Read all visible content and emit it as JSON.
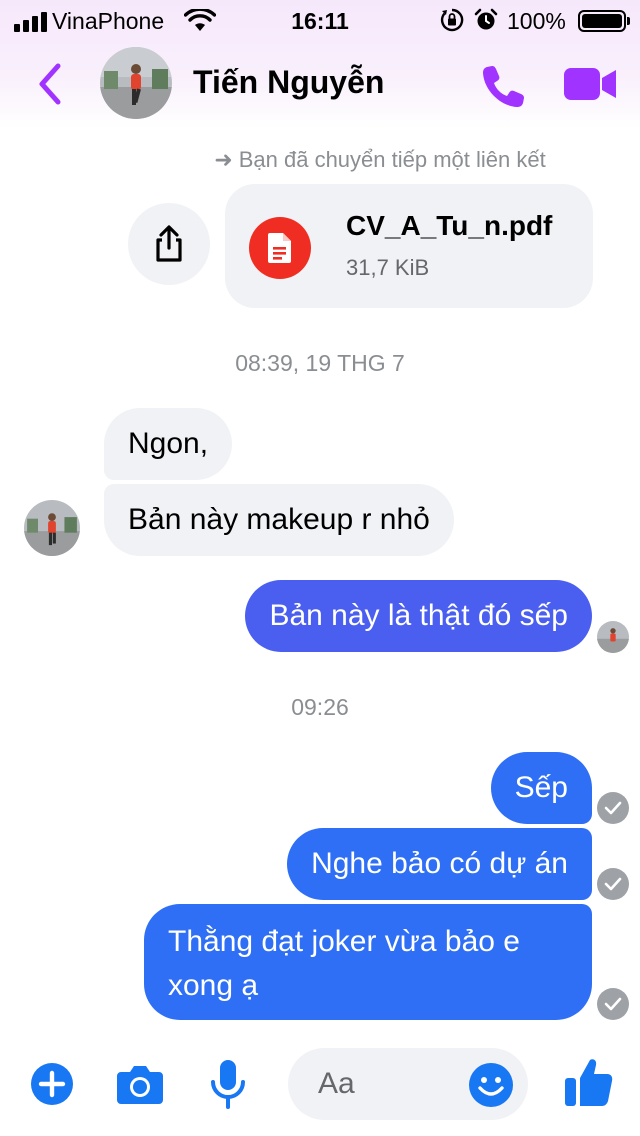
{
  "status_bar": {
    "carrier": "VinaPhone",
    "time": "16:11",
    "battery": "100%"
  },
  "header": {
    "contact_name": "Tiến Nguyễn",
    "icons": [
      "back-chevron-icon",
      "phone-icon",
      "video-camera-icon"
    ],
    "accent_color": "#a033ff"
  },
  "conversation": {
    "forward_note": "Bạn đã chuyển tiếp một liên kết",
    "attachment": {
      "file_name": "CV_A_Tu_n.pdf",
      "file_size": "31,7 KiB",
      "icon": "pdf-document-icon",
      "icon_color": "#f02d23"
    },
    "timestamps": [
      "08:39, 19 THG 7",
      "09:26"
    ],
    "incoming": [
      {
        "text": "Ngon,"
      },
      {
        "text": "Bản này makeup r nhỏ"
      }
    ],
    "outgoing_seen": {
      "text": "Bản này là thật đó sếp"
    },
    "outgoing_sent": [
      {
        "text": "Sếp"
      },
      {
        "text": "Nghe bảo có dự án"
      },
      {
        "text_line1": "Thằng đạt joker vừa bảo e",
        "text_line2": "xong ạ"
      }
    ]
  },
  "composer": {
    "placeholder": "Aa",
    "icons": [
      "plus-icon",
      "camera-icon",
      "microphone-icon",
      "emoji-icon",
      "thumbs-up-icon"
    ],
    "accent_color": "#1877f2"
  }
}
